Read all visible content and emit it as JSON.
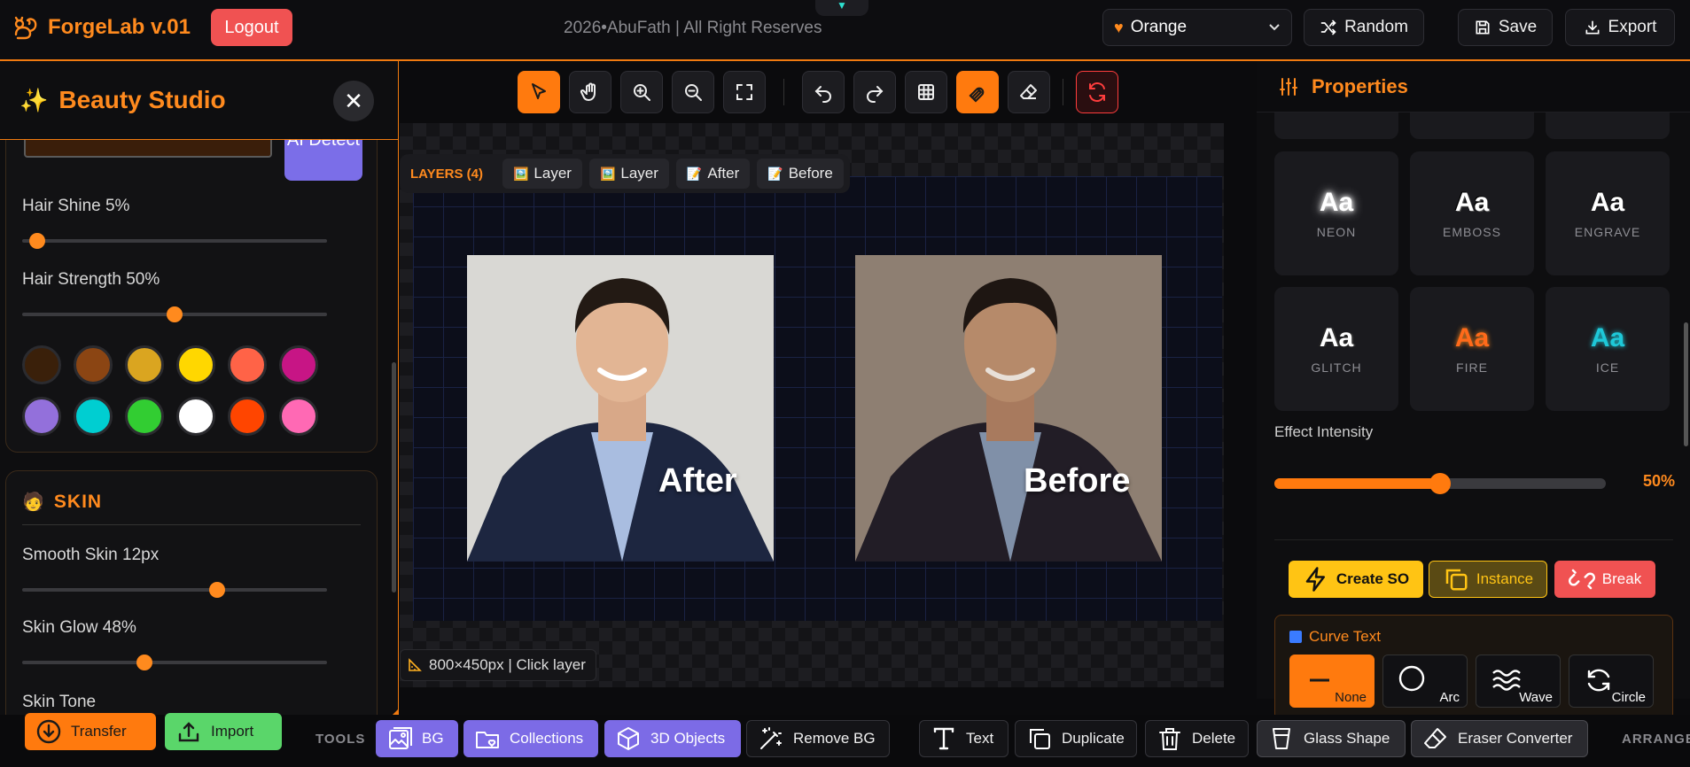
{
  "topbar": {
    "brand": "ForgeLab v.01",
    "logout": "Logout",
    "copyright": "2026•AbuFath | All Right Reserves",
    "notch": "▼",
    "theme": "Orange",
    "random": "Random",
    "save": "Save",
    "export": "Export"
  },
  "beauty_studio": {
    "title": "Beauty Studio",
    "close": "✕",
    "ai_detect": "AI Detect",
    "hair_shine": {
      "label": "Hair Shine 5%",
      "value": 0.05
    },
    "hair_strength": {
      "label": "Hair Strength 50%",
      "value": 0.5
    },
    "hair_colors": [
      "#3a200a",
      "#8b4513",
      "#daa520",
      "#ffd700",
      "#ff6347",
      "#c71585",
      "#9370db",
      "#00ced1",
      "#32cd32",
      "#ffffff",
      "#ff4500",
      "#ff69b4"
    ],
    "skin": {
      "title": "SKIN",
      "smooth": {
        "label": "Smooth Skin 12px",
        "value": 0.64
      },
      "glow": {
        "label": "Skin Glow 48%",
        "value": 0.4
      },
      "tone_label": "Skin Tone"
    }
  },
  "canvas": {
    "layers_label": "LAYERS (4)",
    "layers": [
      {
        "icon": "🖼️",
        "label": "Layer"
      },
      {
        "icon": "🖼️",
        "label": "Layer"
      },
      {
        "icon": "📝",
        "label": "After"
      },
      {
        "icon": "📝",
        "label": "Before"
      }
    ],
    "after_label": "After",
    "before_label": "Before",
    "status": "800×450px | Click layer"
  },
  "properties": {
    "title": "Properties",
    "effects": [
      {
        "label": "NEON"
      },
      {
        "label": "EMBOSS"
      },
      {
        "label": "ENGRAVE"
      },
      {
        "label": "GLITCH"
      },
      {
        "label": "FIRE"
      },
      {
        "label": "ICE"
      }
    ],
    "effect_sample": "Aa",
    "effect_intensity_label": "Effect Intensity",
    "effect_intensity": {
      "value": 0.5,
      "display": "50%"
    },
    "create_so": "Create SO",
    "instance": "Instance",
    "break": "Break",
    "curve_title": "Curve Text",
    "curve_options": [
      "None",
      "Arc",
      "Wave",
      "Circle"
    ]
  },
  "bottombar": {
    "transfer": "Transfer",
    "import": "Import",
    "tools_label": "TOOLS",
    "bg": "BG",
    "collections": "Collections",
    "objects3d": "3D Objects",
    "remove_bg": "Remove BG",
    "text": "Text",
    "duplicate": "Duplicate",
    "delete": "Delete",
    "glass_shape": "Glass Shape",
    "eraser_converter": "Eraser Converter",
    "arrange_label": "ARRANGE"
  },
  "colors": {
    "accent": "#ff7a0e",
    "danger": "#f05252",
    "purple": "#7c6be6"
  }
}
